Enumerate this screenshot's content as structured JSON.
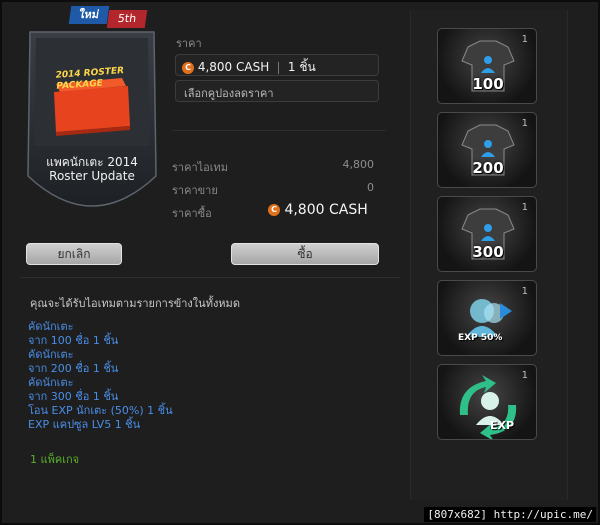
{
  "product": {
    "tag_new": "ใหม่",
    "tag_edition": "5th",
    "box_line1": "2014 ROSTER",
    "box_line2": "PACKAGE",
    "title_line1": "แพคนักเตะ 2014",
    "title_line2": "Roster Update"
  },
  "price": {
    "label": "ราคา",
    "coin_symbol": "C",
    "amount": "4,800",
    "currency": "CASH",
    "quantity": "1",
    "unit": "ชิ้น",
    "coupon_placeholder": "เลือกคูปองลดราคา",
    "item_price_label": "ราคาไอเทม",
    "item_price_value": "4,800",
    "sell_price_label": "ราคาขาย",
    "sell_price_value": "0",
    "buy_price_label": "ราคาซื้อ",
    "buy_price_amount": "4,800",
    "buy_price_currency": "CASH"
  },
  "buttons": {
    "cancel": "ยกเลิก",
    "buy": "ซื้อ"
  },
  "description": {
    "intro": "คุณจะได้รับไอเทมตามรายการข้างในทั้งหมด",
    "items": [
      "คัดนักเตะ",
      "จาก 100 ชื่อ 1 ชิ้น",
      "คัดนักเตะ",
      "จาก 200 ชื่อ 1 ชิ้น",
      "คัดนักเตะ",
      "จาก 300 ชื่อ 1 ชิ้น",
      "โอน EXP นักเตะ (50%) 1 ชิ้น",
      "EXP แคปซูล LV5 1 ชิ้น"
    ],
    "package_count": "1 แพ็คเกจ"
  },
  "rewards": [
    {
      "qty": "1",
      "label": "100",
      "icon": "jersey-pick-icon"
    },
    {
      "qty": "1",
      "label": "200",
      "icon": "jersey-pick-icon"
    },
    {
      "qty": "1",
      "label": "300",
      "icon": "jersey-pick-icon"
    },
    {
      "qty": "1",
      "label": "EXP 50%",
      "icon": "exp-transfer-icon"
    },
    {
      "qty": "1",
      "label": "EXP",
      "icon": "exp-capsule-icon"
    }
  ],
  "watermark": "[807x682] http://upic.me/",
  "colors": {
    "accent_link": "#4a8ee8",
    "package_green": "#5ab02a",
    "coin_orange": "#e0701c",
    "tag_blue": "#1e5aa8",
    "tag_red": "#b3262c"
  }
}
